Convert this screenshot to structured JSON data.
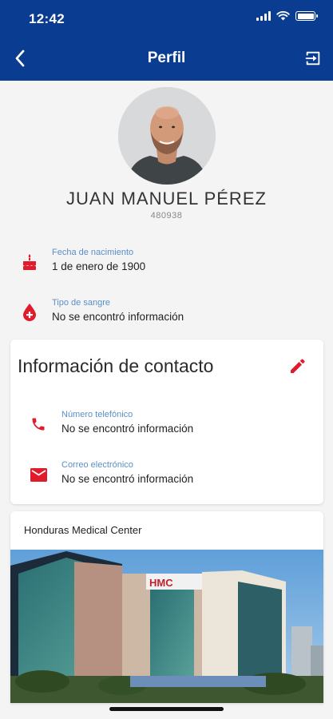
{
  "status_bar": {
    "time": "12:42"
  },
  "header": {
    "title": "Perfil"
  },
  "profile": {
    "name": "JUAN MANUEL PÉREZ",
    "id": "480938",
    "birth": {
      "label": "Fecha de nacimiento",
      "value": "1 de enero de 1900",
      "icon": "cake-icon"
    },
    "blood": {
      "label": "Tipo de sangre",
      "value": "No se encontró información",
      "icon": "blood-drop-icon"
    }
  },
  "contact": {
    "title": "Información de contacto",
    "phone": {
      "label": "Número telefónico",
      "value": "No se encontró información",
      "icon": "phone-icon"
    },
    "email": {
      "label": "Correo electrónico",
      "value": "No se encontró información",
      "icon": "mail-icon"
    }
  },
  "hospital": {
    "name": "Honduras Medical Center",
    "sign_text": "HMC"
  },
  "colors": {
    "primary": "#0a3d91",
    "accent": "#e01b2b",
    "label": "#5a8fc7"
  }
}
